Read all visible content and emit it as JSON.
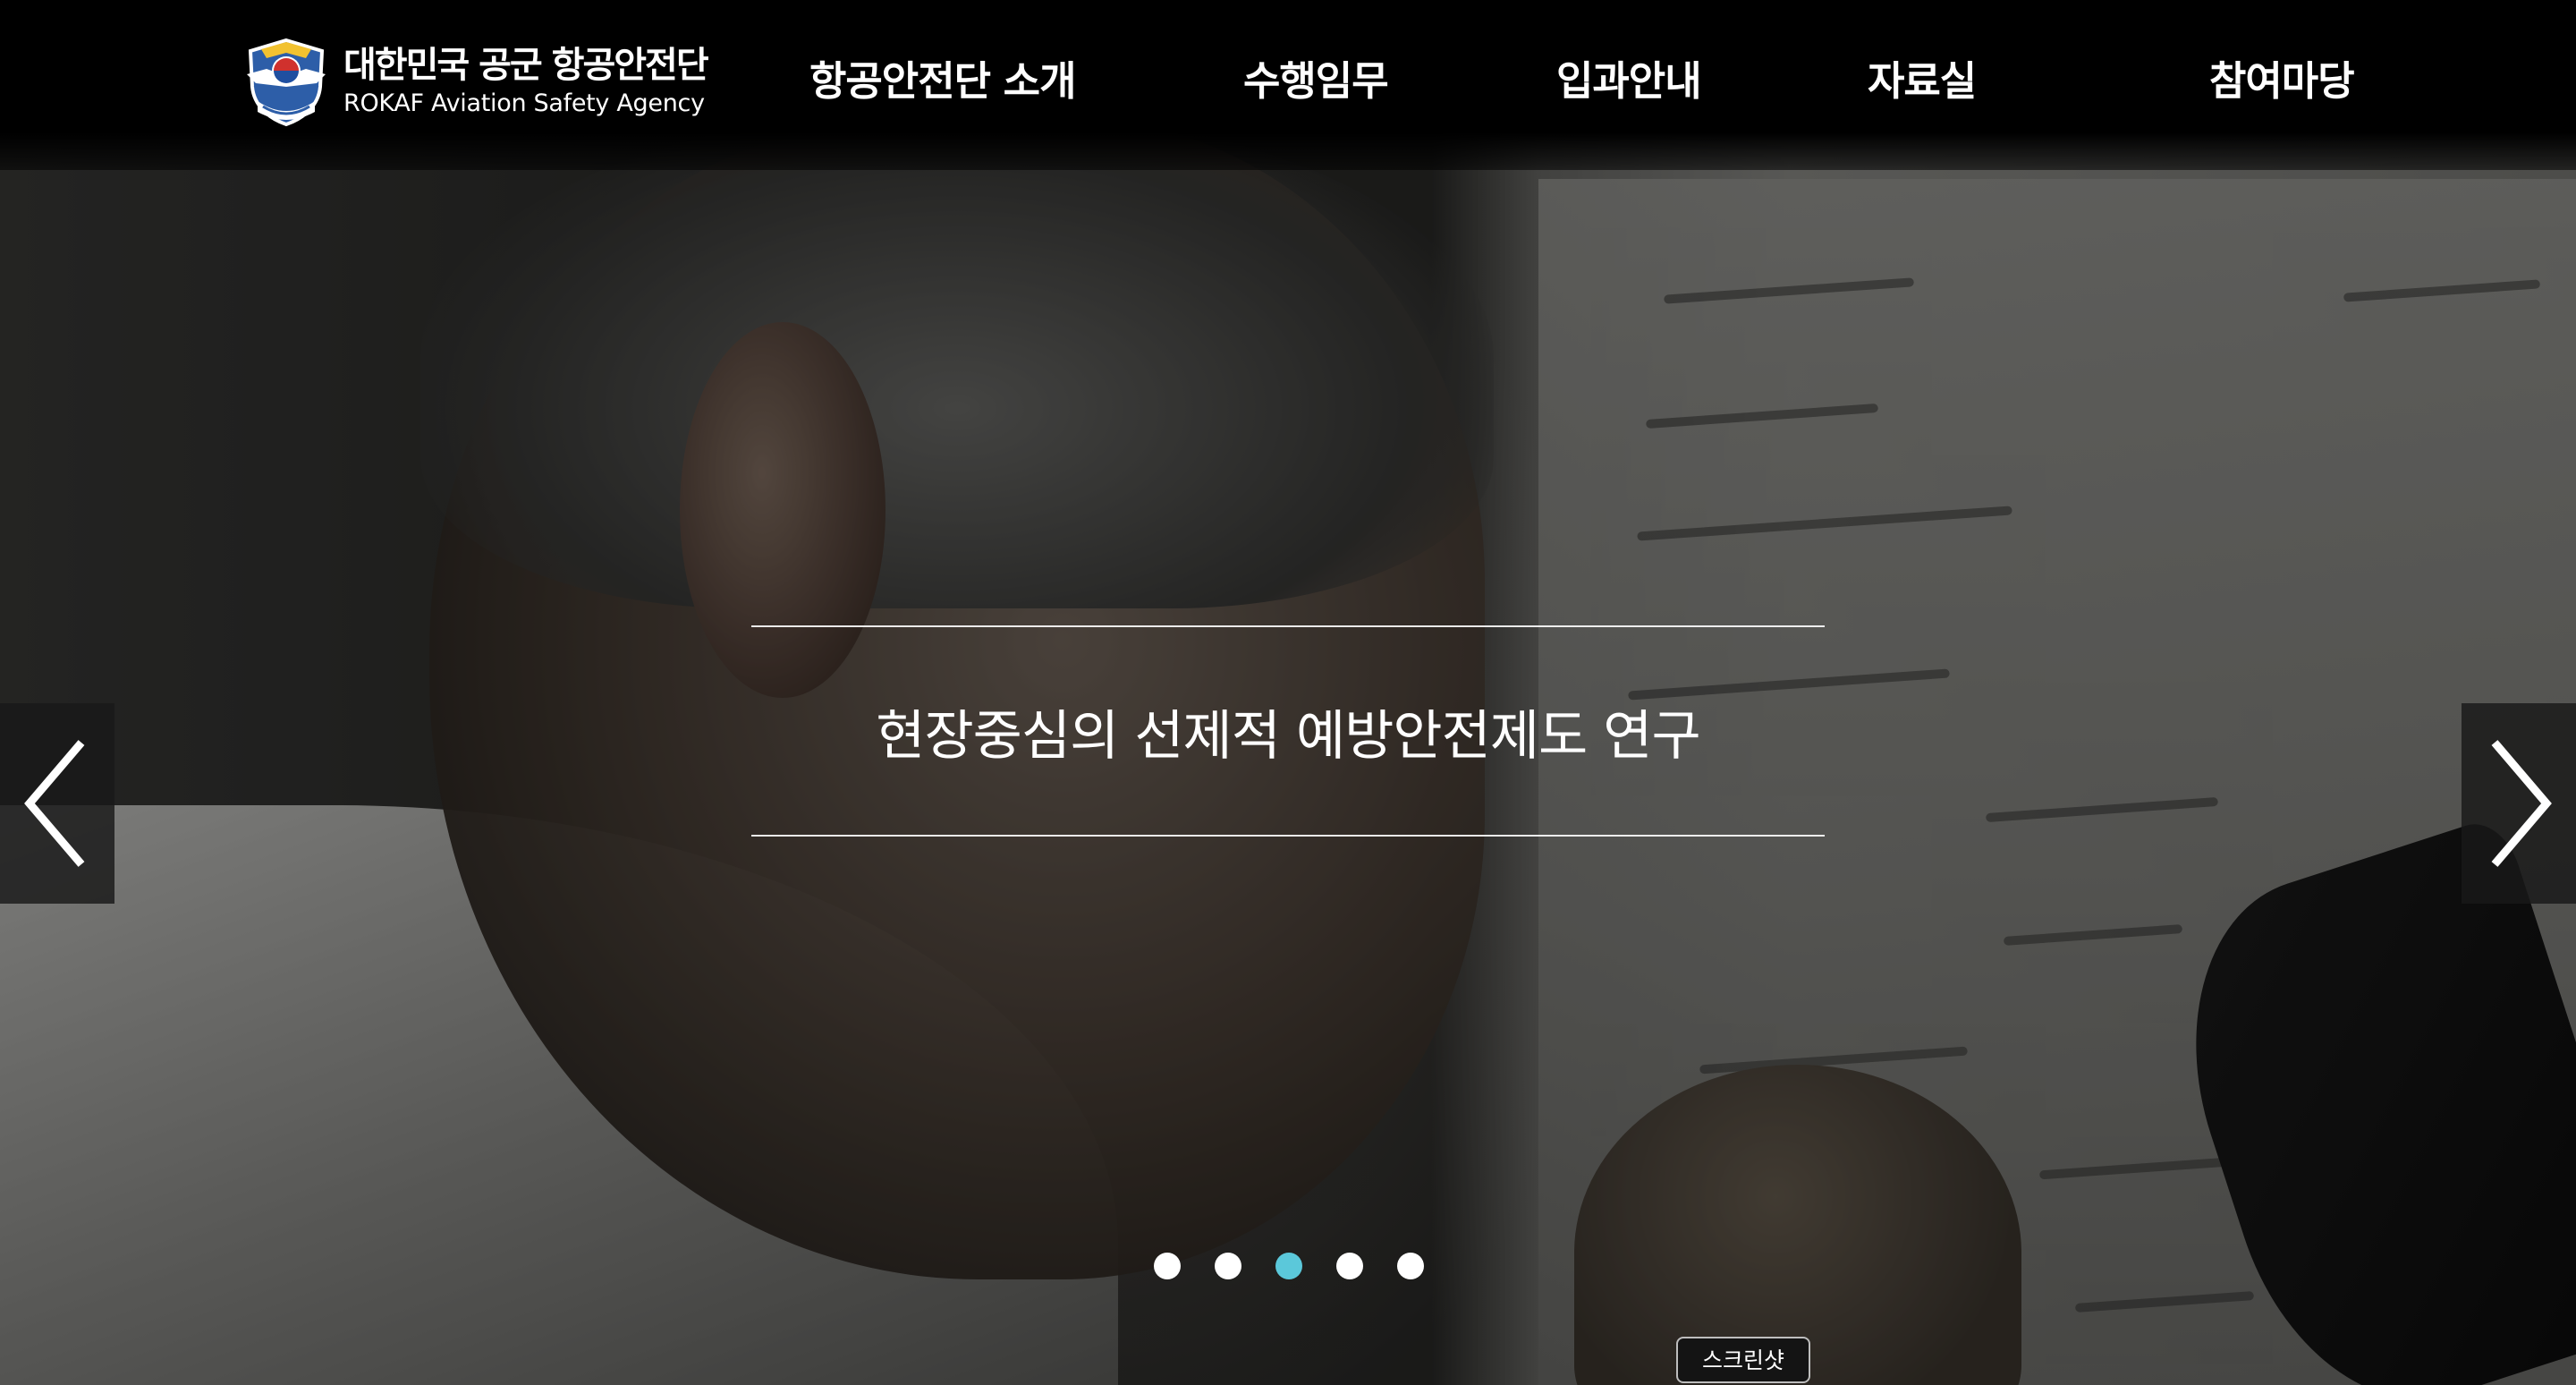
{
  "header": {
    "logo_ko": "대한민국 공군 항공안전단",
    "logo_en": "ROKAF Aviation Safety Agency",
    "nav": [
      {
        "label": "항공안전단 소개"
      },
      {
        "label": "수행임무"
      },
      {
        "label": "입과안내"
      },
      {
        "label": "자료실"
      },
      {
        "label": "참여마당"
      }
    ]
  },
  "slider": {
    "caption": "현장중심의 선제적 예방안전제도 연구",
    "prev_icon": "chevron-left-icon",
    "next_icon": "chevron-right-icon",
    "total_slides": 5,
    "active_slide": 3
  },
  "screenshot_button": {
    "label": "스크린샷"
  },
  "colors": {
    "header_bg": "#000000",
    "text": "#ffffff",
    "dot_active": "#5bc8da",
    "dot_inactive": "#ffffff"
  }
}
